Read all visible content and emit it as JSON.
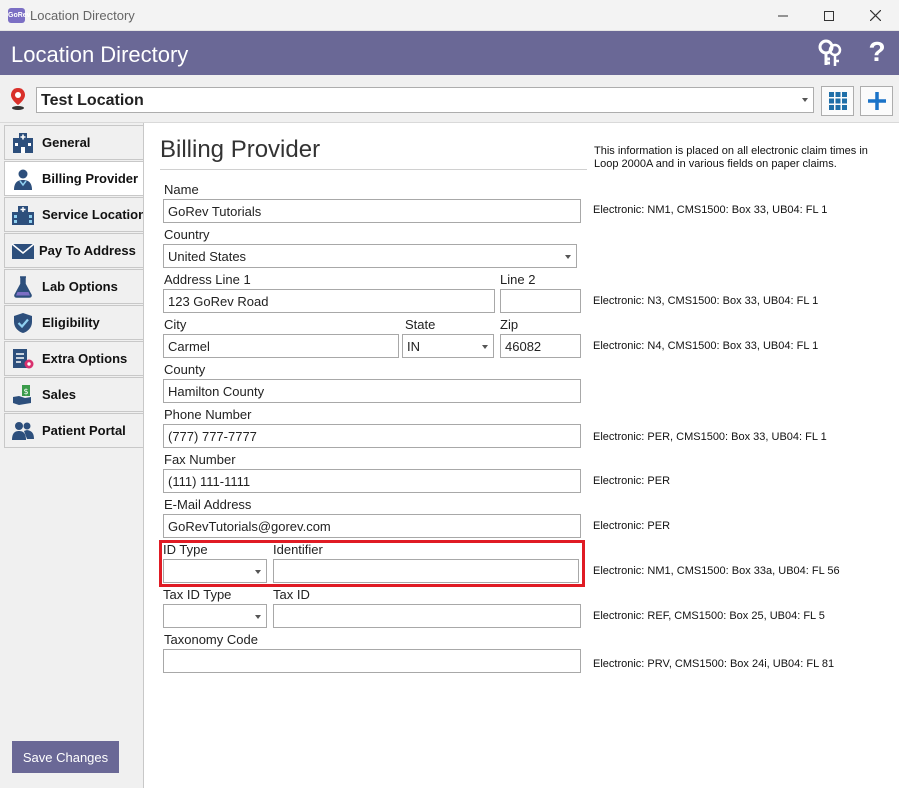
{
  "window": {
    "title": "Location Directory",
    "app_icon_text": "GoRev"
  },
  "header": {
    "title": "Location Directory"
  },
  "location_bar": {
    "selected": "Test Location"
  },
  "sidebar": {
    "items": [
      {
        "label": "General",
        "icon": "hospital-icon",
        "active": false
      },
      {
        "label": "Billing Provider",
        "icon": "doctor-icon",
        "active": true
      },
      {
        "label": "Service Location",
        "icon": "building-icon",
        "active": false
      },
      {
        "label": "Pay To Address",
        "icon": "envelope-icon",
        "active": false
      },
      {
        "label": "Lab Options",
        "icon": "flask-icon",
        "active": false
      },
      {
        "label": "Eligibility",
        "icon": "shield-check-icon",
        "active": false
      },
      {
        "label": "Extra Options",
        "icon": "document-gear-icon",
        "active": false
      },
      {
        "label": "Sales",
        "icon": "money-hand-icon",
        "active": false
      },
      {
        "label": "Patient Portal",
        "icon": "users-icon",
        "active": false
      }
    ],
    "save_label": "Save Changes"
  },
  "main": {
    "title": "Billing Provider",
    "info": "This information is placed on all electronic claim times in Loop 2000A and in various fields on paper claims.",
    "labels": {
      "name": "Name",
      "country": "Country",
      "address1": "Address Line 1",
      "line2": "Line 2",
      "city": "City",
      "state": "State",
      "zip": "Zip",
      "county": "County",
      "phone": "Phone Number",
      "fax": "Fax Number",
      "email": "E-Mail Address",
      "id_type": "ID Type",
      "identifier": "Identifier",
      "tax_id_type": "Tax ID Type",
      "tax_id": "Tax ID",
      "taxonomy": "Taxonomy Code"
    },
    "values": {
      "name": "GoRev Tutorials",
      "country": "United States",
      "address1": "123 GoRev Road",
      "line2": "",
      "city": "Carmel",
      "state": "IN",
      "zip": "46082",
      "county": "Hamilton County",
      "phone": "(777) 777-7777",
      "fax": "(111) 111-1111",
      "email": "GoRevTutorials@gorev.com",
      "id_type": "",
      "identifier": "",
      "tax_id_type": "",
      "tax_id": "",
      "taxonomy": ""
    },
    "electronic": {
      "name": "Electronic: NM1, CMS1500: Box 33, UB04: FL 1",
      "address": "Electronic: N3, CMS1500: Box 33, UB04: FL 1",
      "city": "Electronic: N4, CMS1500: Box 33, UB04: FL 1",
      "phone": "Electronic: PER, CMS1500: Box 33, UB04: FL 1",
      "fax": "Electronic: PER",
      "email": "Electronic: PER",
      "identifier": "Electronic: NM1, CMS1500: Box 33a, UB04: FL 56",
      "tax_id": "Electronic: REF, CMS1500: Box 25, UB04: FL 5",
      "taxonomy": "Electronic: PRV, CMS1500: Box 24i, UB04: FL 81"
    }
  },
  "colors": {
    "header": "#6a6896",
    "highlight": "#e01b24",
    "accent_blue": "#1a73c8"
  }
}
